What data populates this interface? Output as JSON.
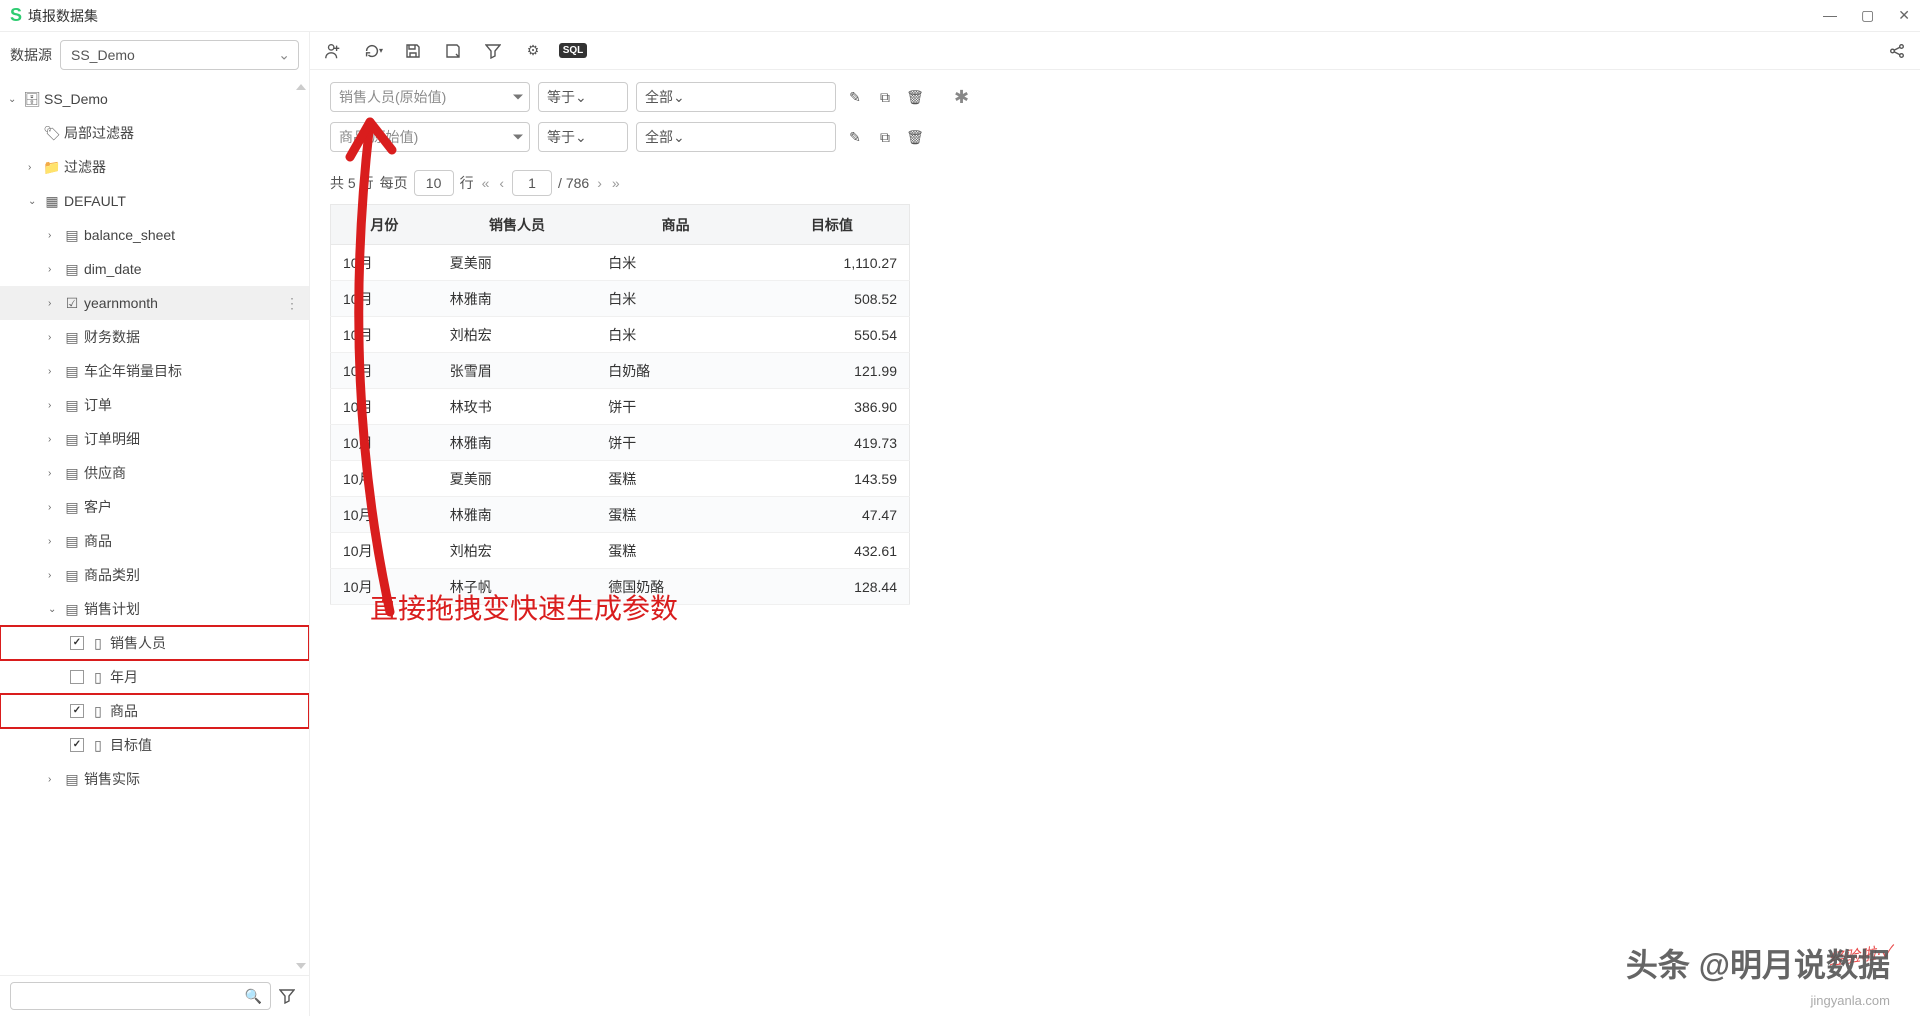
{
  "titlebar": {
    "title": "填报数据集"
  },
  "sidebar": {
    "datasource_label": "数据源",
    "datasource_value": "SS_Demo",
    "tree": {
      "root": "SS_Demo",
      "local_filter": "局部过滤器",
      "filter": "过滤器",
      "default": "DEFAULT",
      "items": {
        "balance_sheet": "balance_sheet",
        "dim_date": "dim_date",
        "yearnmonth": "yearnmonth",
        "fin": "财务数据",
        "car": "车企年销量目标",
        "order": "订单",
        "order_detail": "订单明细",
        "supplier": "供应商",
        "customer": "客户",
        "product": "商品",
        "category": "商品类别",
        "sales_plan": "销售计划",
        "sales_actual": "销售实际",
        "plan_fields": {
          "sales_person": "销售人员",
          "year_month": "年月",
          "product": "商品",
          "target": "目标值"
        }
      }
    }
  },
  "filters": {
    "row1": {
      "field": "销售人员(原始值)",
      "op": "等于",
      "value": "全部"
    },
    "row2": {
      "field": "商品(原始值)",
      "op": "等于",
      "value": "全部"
    }
  },
  "pagination": {
    "total_prefix": "共",
    "total_rows": "5",
    "row_label": "行",
    "per_page_label": "每页",
    "per_page": "10",
    "page": "1",
    "total_pages": "/ 786"
  },
  "table": {
    "headers": [
      "月份",
      "销售人员",
      "商品",
      "目标值"
    ],
    "rows": [
      {
        "month": "10月",
        "person": "夏美丽",
        "product": "白米",
        "value": "1,110.27"
      },
      {
        "month": "10月",
        "person": "林雅南",
        "product": "白米",
        "value": "508.52"
      },
      {
        "month": "10月",
        "person": "刘柏宏",
        "product": "白米",
        "value": "550.54"
      },
      {
        "month": "10月",
        "person": "张雪眉",
        "product": "白奶酪",
        "value": "121.99"
      },
      {
        "month": "10月",
        "person": "林玫书",
        "product": "饼干",
        "value": "386.90"
      },
      {
        "month": "10月",
        "person": "林雅南",
        "product": "饼干",
        "value": "419.73"
      },
      {
        "month": "10月",
        "person": "夏美丽",
        "product": "蛋糕",
        "value": "143.59"
      },
      {
        "month": "10月",
        "person": "林雅南",
        "product": "蛋糕",
        "value": "47.47"
      },
      {
        "month": "10月",
        "person": "刘柏宏",
        "product": "蛋糕",
        "value": "432.61"
      },
      {
        "month": "10月",
        "person": "林子帆",
        "product": "德国奶酪",
        "value": "128.44"
      }
    ]
  },
  "annotation": "直接拖拽变快速生成参数",
  "watermarks": {
    "main": "头条 @明月说数据",
    "site": "jingyanla.com",
    "badge": "经验啦·✓"
  }
}
